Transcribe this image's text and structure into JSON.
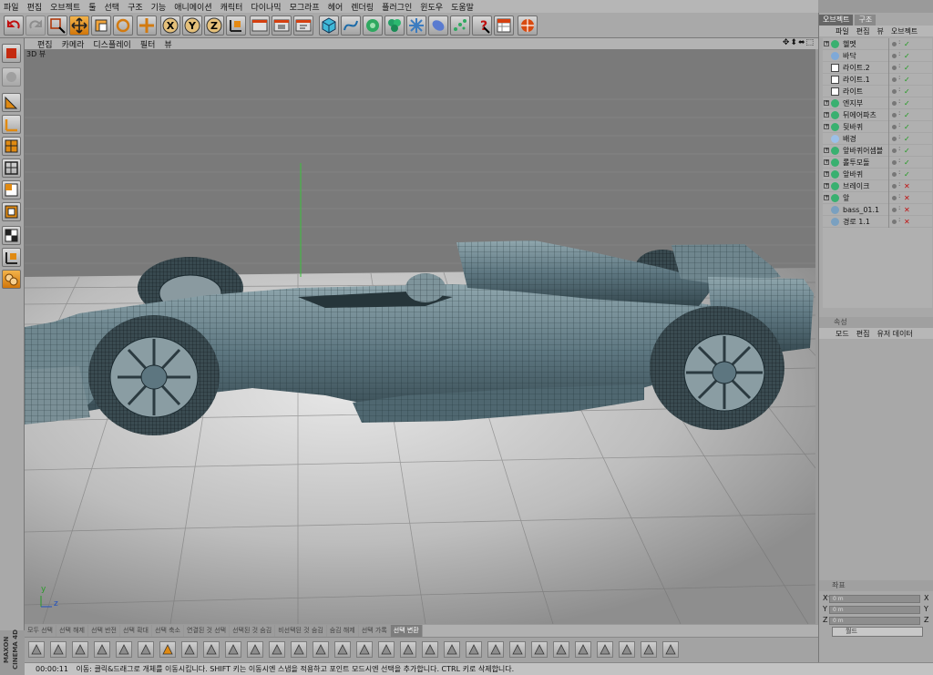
{
  "menu": [
    "파일",
    "편집",
    "오브젝트",
    "툴",
    "선택",
    "구조",
    "기능",
    "애니메이션",
    "캐릭터",
    "다이나믹",
    "모그라프",
    "헤어",
    "렌더링",
    "플러그인",
    "윈도우",
    "도움말"
  ],
  "toolbar": {
    "icons": [
      "undo-icon",
      "redo-icon",
      "select-icon",
      "move-icon",
      "scale-icon",
      "rotate-icon",
      "add-icon",
      "x-axis-icon",
      "y-axis-icon",
      "z-axis-icon",
      "coord-system-icon",
      "render-view-icon",
      "render-picture-icon",
      "render-settings-icon",
      "cube-icon",
      "spline-icon",
      "nurbs-icon",
      "array-icon",
      "deformer-icon",
      "scene-icon",
      "particle-icon",
      "help-icon",
      "layout-icon",
      "browser-icon"
    ],
    "axis_labels": [
      "X",
      "Y",
      "Z"
    ]
  },
  "viewport": {
    "menu": [
      "편집",
      "카메라",
      "디스플레이",
      "필터",
      "뷰"
    ],
    "label": "3D 뷰",
    "axis_y": "y",
    "axis_z": "z"
  },
  "object_manager": {
    "tabs": [
      "오브젝트",
      "구조"
    ],
    "menu": [
      "파일",
      "편집",
      "뷰",
      "오브젝트"
    ],
    "objects": [
      {
        "name": "헬멧",
        "icon": "null-icon",
        "check": "✓",
        "check_color": "g"
      },
      {
        "name": "바닥",
        "icon": "floor-icon",
        "check": "✓",
        "check_color": "g"
      },
      {
        "name": "라이트.2",
        "icon": "light-icon",
        "check": "✓",
        "check_color": "g"
      },
      {
        "name": "라이트.1",
        "icon": "light-icon",
        "check": "✓",
        "check_color": "g"
      },
      {
        "name": "라이트",
        "icon": "light-icon",
        "check": "✓",
        "check_color": "g"
      },
      {
        "name": "엔지부",
        "icon": "null-icon",
        "check": "✓",
        "check_color": "g"
      },
      {
        "name": "뒤에어파츠",
        "icon": "null-icon",
        "check": "✓",
        "check_color": "g"
      },
      {
        "name": "뒷바퀴",
        "icon": "null-icon",
        "check": "✓",
        "check_color": "g"
      },
      {
        "name": "배경",
        "icon": "background-icon",
        "check": "✓",
        "check_color": "g"
      },
      {
        "name": "앞바퀴어셈블",
        "icon": "null-icon",
        "check": "✓",
        "check_color": "g"
      },
      {
        "name": "롤투모돌",
        "icon": "null-icon",
        "check": "✓",
        "check_color": "g"
      },
      {
        "name": "앞바퀴",
        "icon": "null-icon",
        "check": "✓",
        "check_color": "g"
      },
      {
        "name": "브레이크",
        "icon": "null-icon",
        "check": "✕",
        "check_color": "r"
      },
      {
        "name": "앞",
        "icon": "null-icon",
        "check": "✕",
        "check_color": "r"
      },
      {
        "name": "bass_01.1",
        "icon": "path-icon",
        "check": "✕",
        "check_color": "r"
      },
      {
        "name": "경로 1.1",
        "icon": "path-icon",
        "check": "✕",
        "check_color": "r"
      }
    ]
  },
  "attributes": {
    "title": "속성",
    "menu": [
      "모드",
      "편집",
      "유저 데이터"
    ]
  },
  "coordinates": {
    "title": "좌표",
    "separator": "---",
    "rows": [
      {
        "axis": "X",
        "value": "0 m",
        "axis2": "X"
      },
      {
        "axis": "Y",
        "value": "0 m",
        "axis2": "Y"
      },
      {
        "axis": "Z",
        "value": "0 m",
        "axis2": "Z"
      }
    ],
    "mode": "월드"
  },
  "mode_tabs": [
    "모두 선택",
    "선택 해제",
    "선택 반전",
    "선택 확대",
    "선택 축소",
    "연결된 것 선택",
    "선택된 것 숨김",
    "비선택된 것 숨김",
    "숨김 해제",
    "선택 가록",
    "선택 변환"
  ],
  "mode_tabs_active": 10,
  "status": {
    "time": "00:00:11",
    "text": "이동: 클릭&드래그로 개체를 이동시킵니다. SHIFT 키는 이동시엔 스냅을 적용하고 포인트 모드시엔 선택을 추가합니다. CTRL 키로 삭제합니다."
  },
  "logo": "MAXON CINEMA 4D",
  "colors": {
    "car": "#5d7680",
    "wire": "#1b2a30",
    "accent": "#e08a12"
  }
}
